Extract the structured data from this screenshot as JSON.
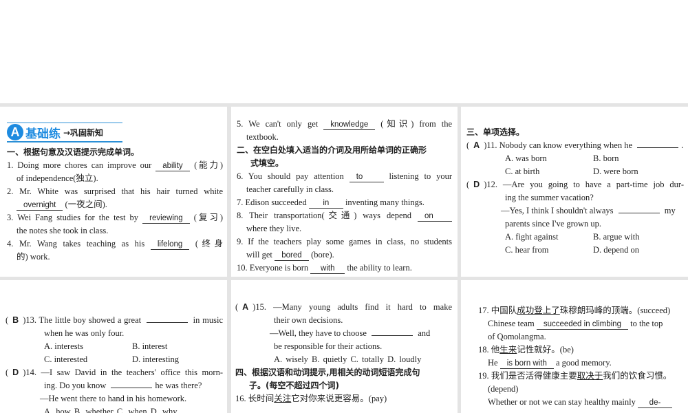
{
  "header": {
    "badge": "A",
    "title": "基础练",
    "subtitle": "→巩固新知"
  },
  "panels": [
    {
      "lines": [
        {
          "kind": "heading",
          "segs": [
            {
              "t": "一、根据句意及汉语提示完成单词。"
            }
          ]
        },
        {
          "kind": "j",
          "segs": [
            {
              "t": "1. Doing more chores can improve our "
            },
            {
              "a": "ability"
            },
            {
              "t": " (能力)"
            }
          ]
        },
        {
          "kind": "cont",
          "segs": [
            {
              "t": "of independence(独立)."
            }
          ]
        },
        {
          "kind": "j",
          "segs": [
            {
              "t": "2. Mr. White was surprised that his hair turned white"
            }
          ]
        },
        {
          "kind": "cont",
          "segs": [
            {
              "a": "overnight"
            },
            {
              "t": " (一夜之间)."
            }
          ]
        },
        {
          "kind": "j",
          "segs": [
            {
              "t": "3. Wei Fang studies for the test by "
            },
            {
              "a": "reviewing"
            },
            {
              "t": " (复习)"
            }
          ]
        },
        {
          "kind": "cont",
          "segs": [
            {
              "t": "the notes she took in class."
            }
          ]
        },
        {
          "kind": "j",
          "segs": [
            {
              "t": "4. Mr. Wang takes teaching as his "
            },
            {
              "a": "lifelong"
            },
            {
              "t": " (终身"
            }
          ]
        },
        {
          "kind": "cont",
          "segs": [
            {
              "t": "的) work."
            }
          ]
        }
      ]
    },
    {
      "lines": [
        {
          "kind": "j",
          "segs": [
            {
              "t": "5. We can't only get "
            },
            {
              "a": "knowledge"
            },
            {
              "t": " (知识) from the"
            }
          ]
        },
        {
          "kind": "cont",
          "segs": [
            {
              "t": "textbook."
            }
          ]
        },
        {
          "kind": "heading",
          "segs": [
            {
              "t": "二、在空白处填入适当的介词及用所给单词的正确形"
            }
          ]
        },
        {
          "kind": "heading2",
          "segs": [
            {
              "t": "式填空。"
            }
          ]
        },
        {
          "kind": "j",
          "segs": [
            {
              "t": "6. You should pay attention "
            },
            {
              "a": "to"
            },
            {
              "t": " listening to your"
            }
          ]
        },
        {
          "kind": "cont",
          "segs": [
            {
              "t": "teacher carefully in class."
            }
          ]
        },
        {
          "kind": "plain",
          "segs": [
            {
              "t": "7. Edison succeeded "
            },
            {
              "a": "in"
            },
            {
              "t": " inventing many things."
            }
          ]
        },
        {
          "kind": "j",
          "segs": [
            {
              "t": "8. Their transportation(交通) ways depend "
            },
            {
              "a": "on"
            }
          ]
        },
        {
          "kind": "cont",
          "segs": [
            {
              "t": "where they live."
            }
          ]
        },
        {
          "kind": "j",
          "segs": [
            {
              "t": "9. If the teachers play some games in class, no students"
            }
          ]
        },
        {
          "kind": "cont",
          "segs": [
            {
              "t": "will get "
            },
            {
              "a": "bored"
            },
            {
              "t": " (bore)."
            }
          ]
        },
        {
          "kind": "plain",
          "segs": [
            {
              "t": "10. Everyone is born "
            },
            {
              "a": "with"
            },
            {
              "t": " the ability to learn."
            }
          ]
        }
      ]
    },
    {
      "lines": [
        {
          "kind": "heading",
          "segs": [
            {
              "t": "三、单项选择。"
            }
          ]
        },
        {
          "kind": "plain",
          "segs": [
            {
              "c": "A"
            },
            {
              "t": ")11. Nobody can know everything when he "
            },
            {
              "b": ""
            },
            {
              "t": "."
            }
          ]
        },
        {
          "kind": "options",
          "segs": [
            {
              "o": "A. was born"
            },
            {
              "o": "B. born"
            }
          ]
        },
        {
          "kind": "options",
          "segs": [
            {
              "o": "C. at birth"
            },
            {
              "o": "D. were born"
            }
          ]
        },
        {
          "kind": "j",
          "segs": [
            {
              "c": "D"
            },
            {
              "t": ")12. —Are you going to have a part-time job dur-"
            }
          ]
        },
        {
          "kind": "cont2",
          "segs": [
            {
              "t": "ing the summer vacation?"
            }
          ]
        },
        {
          "kind": "sub",
          "segs": [
            {
              "t": "—Yes, I think I shouldn't always "
            },
            {
              "b": ""
            },
            {
              "t": " my"
            }
          ]
        },
        {
          "kind": "cont2",
          "segs": [
            {
              "t": "parents since I've grown up."
            }
          ]
        },
        {
          "kind": "options",
          "segs": [
            {
              "o": "A. fight against"
            },
            {
              "o": "B. argue with"
            }
          ]
        },
        {
          "kind": "options",
          "segs": [
            {
              "o": "C. hear from"
            },
            {
              "o": "D. depend on"
            }
          ]
        }
      ]
    },
    {
      "lines": [
        {
          "kind": "j",
          "segs": [
            {
              "c": "B"
            },
            {
              "t": ")13. The little boy showed a great "
            },
            {
              "b": ""
            },
            {
              "t": " in music"
            }
          ]
        },
        {
          "kind": "cont2",
          "segs": [
            {
              "t": "when he was only four."
            }
          ]
        },
        {
          "kind": "options",
          "segs": [
            {
              "o": "A. interests"
            },
            {
              "o": "B. interest"
            }
          ]
        },
        {
          "kind": "options",
          "segs": [
            {
              "o": "C. interested"
            },
            {
              "o": "D. interesting"
            }
          ]
        },
        {
          "kind": "j",
          "segs": [
            {
              "c": "D"
            },
            {
              "t": ")14. —I saw David in the teachers' office this morn-"
            }
          ]
        },
        {
          "kind": "cont2",
          "segs": [
            {
              "t": "ing. Do you know "
            },
            {
              "b": ""
            },
            {
              "t": "he was there?"
            }
          ]
        },
        {
          "kind": "sub",
          "segs": [
            {
              "t": "—He went there to hand in his homework."
            }
          ]
        },
        {
          "kind": "options5",
          "segs": [
            {
              "t": "A. how    B. whether C. when    D. why"
            }
          ]
        }
      ]
    },
    {
      "lines": [
        {
          "kind": "j",
          "segs": [
            {
              "c": "A"
            },
            {
              "t": ")15. —Many young adults find it hard to make"
            }
          ]
        },
        {
          "kind": "cont2",
          "segs": [
            {
              "t": "their own decisions."
            }
          ]
        },
        {
          "kind": "sub",
          "segs": [
            {
              "t": "—Well, they have to choose "
            },
            {
              "b": ""
            },
            {
              "t": " and"
            }
          ]
        },
        {
          "kind": "cont2",
          "segs": [
            {
              "t": "be responsible for their actions."
            }
          ]
        },
        {
          "kind": "options5",
          "segs": [
            {
              "t": "A. wisely B. quietly  C. totally  D. loudly"
            }
          ]
        },
        {
          "kind": "heading",
          "segs": [
            {
              "t": "四、根据汉语和动词提示,用相关的动词短语完成句"
            }
          ]
        },
        {
          "kind": "heading2",
          "segs": [
            {
              "t": "子。(每空不超过四个词)"
            }
          ]
        },
        {
          "kind": "plain",
          "segs": [
            {
              "t": "16. 长时间"
            },
            {
              "u": "关注"
            },
            {
              "t": "它对你来说更容易。(pay)"
            }
          ]
        }
      ]
    },
    {
      "lines": [
        {
          "kind": "plain",
          "segs": [
            {
              "t": "17. 中国队"
            },
            {
              "u": "成功登上了"
            },
            {
              "t": "珠穆朗玛峰的顶端。(succeed)"
            }
          ]
        },
        {
          "kind": "cont",
          "segs": [
            {
              "t": "Chinese team "
            },
            {
              "a": "succeeded in climbing"
            },
            {
              "t": " to the top"
            }
          ]
        },
        {
          "kind": "cont",
          "segs": [
            {
              "t": "of Qomolangma."
            }
          ]
        },
        {
          "kind": "plain",
          "segs": [
            {
              "t": "18. 他"
            },
            {
              "u": "生来"
            },
            {
              "t": "记性就好。(be)"
            }
          ]
        },
        {
          "kind": "cont",
          "segs": [
            {
              "t": "He "
            },
            {
              "a": "is born with"
            },
            {
              "t": " a good memory."
            }
          ]
        },
        {
          "kind": "plain",
          "segs": [
            {
              "t": "19. 我们是否活得健康主要"
            },
            {
              "u": "取决于"
            },
            {
              "t": "我们的饮食习惯。"
            }
          ]
        },
        {
          "kind": "cont",
          "segs": [
            {
              "t": "(depend)"
            }
          ]
        },
        {
          "kind": "cont",
          "segs": [
            {
              "t": "Whether or not we can stay healthy mainly "
            },
            {
              "a": "de-"
            }
          ]
        }
      ]
    }
  ]
}
